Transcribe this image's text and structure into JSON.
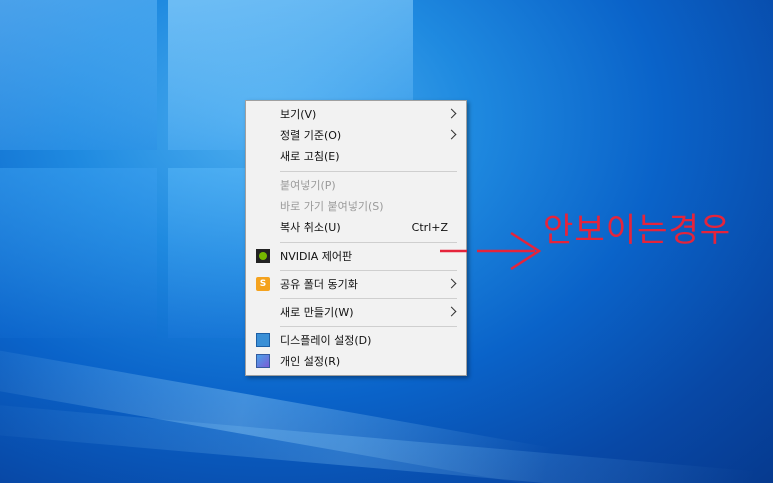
{
  "desktop": {
    "context_menu": {
      "groups": [
        [
          {
            "label": "보기(V)",
            "submenu": true,
            "disabled": false
          },
          {
            "label": "정렬 기준(O)",
            "submenu": true,
            "disabled": false
          },
          {
            "label": "새로 고침(E)",
            "submenu": false,
            "disabled": false
          }
        ],
        [
          {
            "label": "붙여넣기(P)",
            "disabled": true
          },
          {
            "label": "바로 가기 붙여넣기(S)",
            "disabled": true
          },
          {
            "label": "복사 취소(U)",
            "shortcut": "Ctrl+Z",
            "disabled": false
          }
        ],
        [
          {
            "label": "NVIDIA 제어판",
            "icon": "nvidia-icon"
          }
        ],
        [
          {
            "label": "공유 폴더 동기화",
            "icon": "sync-folder-icon",
            "icon_glyph": "S",
            "submenu": true
          }
        ],
        [
          {
            "label": "새로 만들기(W)",
            "submenu": true
          }
        ],
        [
          {
            "label": "디스플레이 설정(D)",
            "icon": "display-icon"
          },
          {
            "label": "개인 설정(R)",
            "icon": "personalize-icon"
          }
        ]
      ]
    },
    "annotation": {
      "text": "안보이는경우",
      "color": "#e5243b"
    }
  }
}
